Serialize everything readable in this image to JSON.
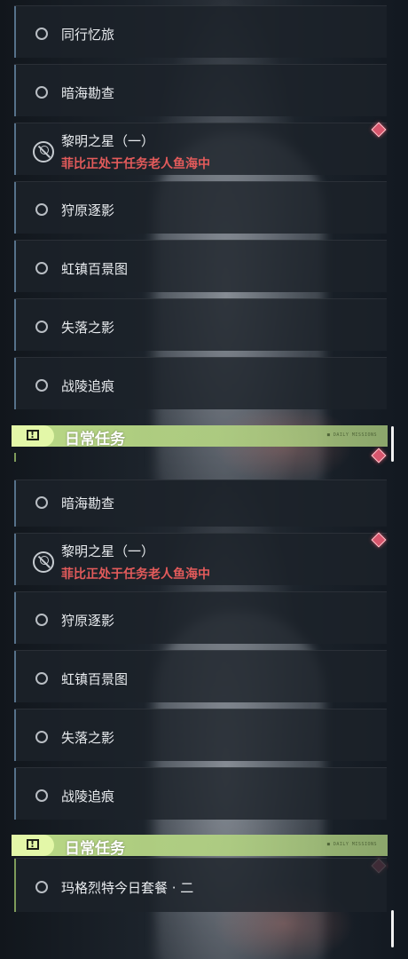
{
  "panel_top": {
    "items": [
      {
        "title": "同行忆旅"
      },
      {
        "title": "暗海勘查"
      },
      {
        "title": "黎明之星（一）",
        "subtitle": "菲比正处于任务老人鱼海中"
      },
      {
        "title": "狩原逐影"
      },
      {
        "title": "虹镇百景图"
      },
      {
        "title": "失落之影"
      },
      {
        "title": "战陵追痕"
      }
    ],
    "section_header": {
      "label": "日常任务",
      "decor_text": "■ DAILY MISSIONS"
    }
  },
  "panel_bottom": {
    "items": [
      {
        "title": "暗海勘查"
      },
      {
        "title": "黎明之星（一）",
        "subtitle": "菲比正处于任务老人鱼海中"
      },
      {
        "title": "狩原逐影"
      },
      {
        "title": "虹镇百景图"
      },
      {
        "title": "失落之影"
      },
      {
        "title": "战陵追痕"
      }
    ],
    "section_header": {
      "label": "日常任务",
      "decor_text": "■ DAILY MISSIONS"
    },
    "daily_items": [
      {
        "title": "玛格烈特今日套餐 · 二"
      }
    ]
  },
  "colors": {
    "header_green": "#bede89",
    "badge_green": "#e3f7a8",
    "alert_red": "#e35b5b",
    "marker_pink": "#d8566d",
    "accent_blue": "#56718a",
    "accent_green": "#7e9b5a"
  },
  "icons": {
    "quest": "radio-circle-icon",
    "locked_quest": "locked-quest-icon",
    "tracked": "diamond-marker-icon",
    "section": "exclamation-box-icon"
  }
}
